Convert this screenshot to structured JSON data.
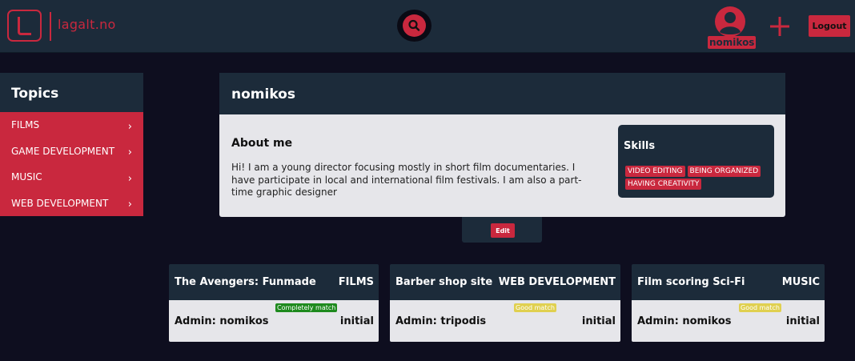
{
  "header": {
    "logo_text": "lagalt.no",
    "username": "nomikos",
    "logout_label": "Logout"
  },
  "sidebar": {
    "title": "Topics",
    "items": [
      {
        "label": "FILMS"
      },
      {
        "label": "GAME DEVELOPMENT"
      },
      {
        "label": "MUSIC"
      },
      {
        "label": "WEB DEVELOPMENT"
      }
    ],
    "chevron": "›"
  },
  "profile": {
    "name": "nomikos",
    "about_title": "About me",
    "about_text": "Hi! I am a young director focusing mostly in short film documentaries. I have participate in local and international film festivals. I am also a part-time graphic designer",
    "skills_title": "Skills",
    "skills": [
      "VIDEO EDITING",
      "BEING ORGANIZED",
      "HAVING CREATIVITY"
    ],
    "edit_label": "Edit"
  },
  "projects": [
    {
      "title": "The Avengers: Funmade",
      "category": "FILMS",
      "admin": "Admin: nomikos",
      "status": "initial",
      "match": "Completely match",
      "match_color": "#1e8a1e"
    },
    {
      "title": "Barber shop site",
      "category": "WEB DEVELOPMENT",
      "admin": "Admin: tripodis",
      "status": "initial",
      "match": "Good match",
      "match_color": "#e0d050"
    },
    {
      "title": "Film scoring Sci-Fi",
      "category": "MUSIC",
      "admin": "Admin: nomikos",
      "status": "initial",
      "match": "Good match",
      "match_color": "#e0d050"
    }
  ],
  "colors": {
    "accent": "#c9283e",
    "panel": "#1c2b3a",
    "background": "#0e0e1f",
    "card": "#e6e6ea"
  },
  "icons": {
    "logo": "lagalt-logo-icon",
    "search": "search-icon",
    "user": "user-avatar-icon",
    "add": "plus-icon"
  }
}
